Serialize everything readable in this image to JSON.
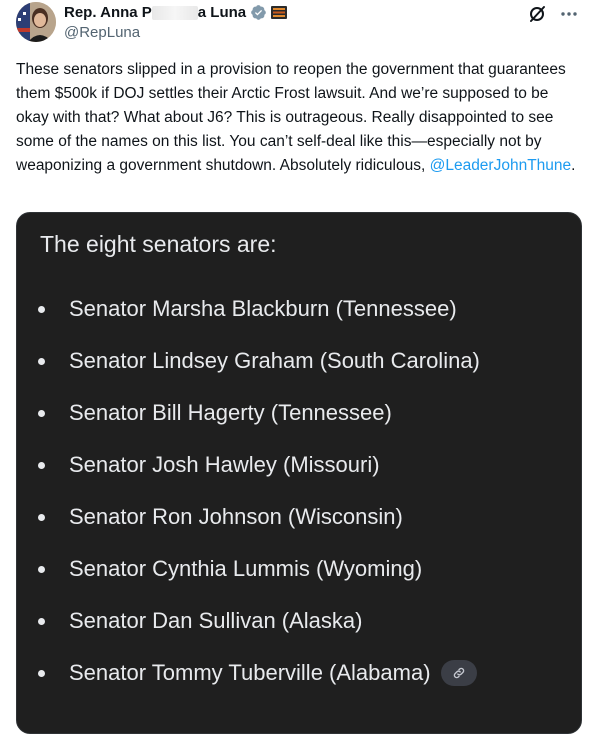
{
  "author": {
    "name_start": "Rep. Anna P",
    "name_end": "a Luna",
    "handle": "@RepLuna"
  },
  "tweet": {
    "text": "These senators slipped in a provision to reopen the government that guarantees them $500k if DOJ settles their Arctic Frost lawsuit. And we’re supposed to be okay with that? What about J6? This is outrageous. Really disappointed to see some of the names on this list. You can’t self-deal like this—especially not by weaponizing a government shutdown. Absolutely ridiculous, ",
    "mention": "@LeaderJohnThune",
    "end": "."
  },
  "media": {
    "title": "The eight senators are:",
    "items": [
      "Senator Marsha Blackburn (Tennessee)",
      "Senator Lindsey Graham (South Carolina)",
      "Senator Bill Hagerty (Tennessee)",
      "Senator Josh Hawley (Missouri)",
      "Senator Ron Johnson (Wisconsin)",
      "Senator Cynthia Lummis (Wyoming)",
      "Senator Dan Sullivan (Alaska)",
      "Senator Tommy Tuberville (Alabama)"
    ]
  },
  "icons": {
    "verified": "verified-badge-icon",
    "affiliation": "affiliation-badge-icon",
    "grok": "grok-icon",
    "more": "more-icon",
    "link": "link-icon"
  },
  "colors": {
    "link": "#1d9bf0",
    "verified": "#829aab",
    "media_bg": "#1f1f1f",
    "media_text": "#e8eaed"
  }
}
